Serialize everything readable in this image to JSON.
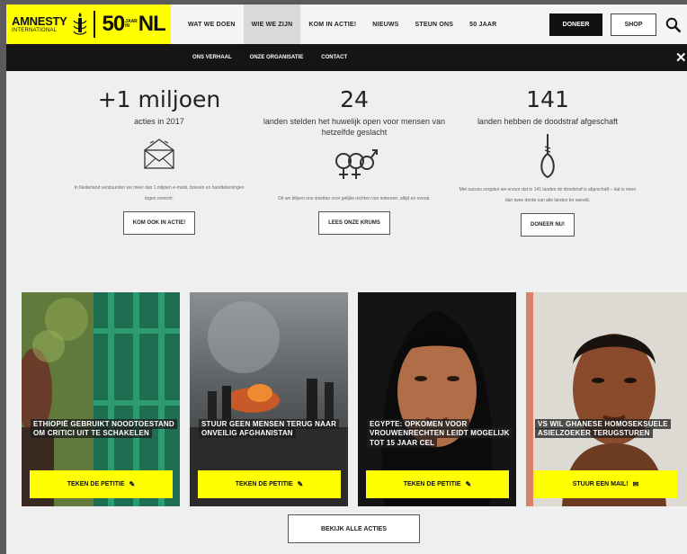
{
  "logo": {
    "main": "AMNESTY",
    "sub": "INTERNATIONAL",
    "fifty": "50",
    "jaar_top": "JAAR",
    "jaar_bottom": "IN",
    "nl": "NL"
  },
  "nav": {
    "items": [
      "WAT WE DOEN",
      "WIE WE ZIJN",
      "KOM IN ACTIE!",
      "NIEUWS",
      "STEUN ONS",
      "50 JAAR"
    ],
    "active_index": 1
  },
  "header": {
    "doneer_label": "DONEER",
    "shop_label": "SHOP"
  },
  "subnav": {
    "items": [
      "ONS VERHAAL",
      "ONZE ORGANISATIE",
      "CONTACT"
    ]
  },
  "stats": [
    {
      "big": "+1 miljoen",
      "caption": "acties in 2017",
      "icon": "envelope-icon",
      "text": "In Nederland verstuurden we meer dan 1 miljoen e-mails, brieven en handtekeningen tegen onrecht.",
      "button": "KOM OOK IN ACTIE!"
    },
    {
      "big": "24",
      "caption": "landen stelden het huwelijk open voor mensen van hetzelfde geslacht",
      "icon": "gender-symbols-icon",
      "text": "Dit we blijven ons inzetten voor gelijke rechten van iedereen, altijd en overal.",
      "button": "LEES ONZE KRUMS"
    },
    {
      "big": "141",
      "caption": "landen hebben de doodstraf afgeschaft",
      "icon": "noose-icon",
      "text": "Met succes zorgden we ervoor dat in 141 landen de doodstraf is afgeschaft – dat is meer dan twee derde van alle landen ter wereld.",
      "button": "DONEER NU!"
    }
  ],
  "cards": [
    {
      "title": "ETHIOPIË GEBRUIKT NOODTOESTAND OM CRITICI UIT TE SCHAKELEN",
      "button": "TEKEN DE PETITIE",
      "icon": "pencil-icon"
    },
    {
      "title": "STUUR GEEN MENSEN TERUG NAAR ONVEILIG AFGHANISTAN",
      "button": "TEKEN DE PETITIE",
      "icon": "pencil-icon"
    },
    {
      "title": "EGYPTE: OPKOMEN VOOR VROUWENRECHTEN LEIDT MOGELIJK TOT 15 JAAR CEL",
      "button": "TEKEN DE PETITIE",
      "icon": "pencil-icon"
    },
    {
      "title": "VS WIL GHANESE HOMOSEKSUELE ASIELZOEKER TERUGSTUREN",
      "button": "STUUR EEN MAIL!",
      "icon": "mail-icon"
    }
  ],
  "all_actions_label": "BEKIJK ALLE ACTIES",
  "colors": {
    "brand_yellow": "#ffff00",
    "dark": "#151515",
    "background": "#efefef"
  }
}
